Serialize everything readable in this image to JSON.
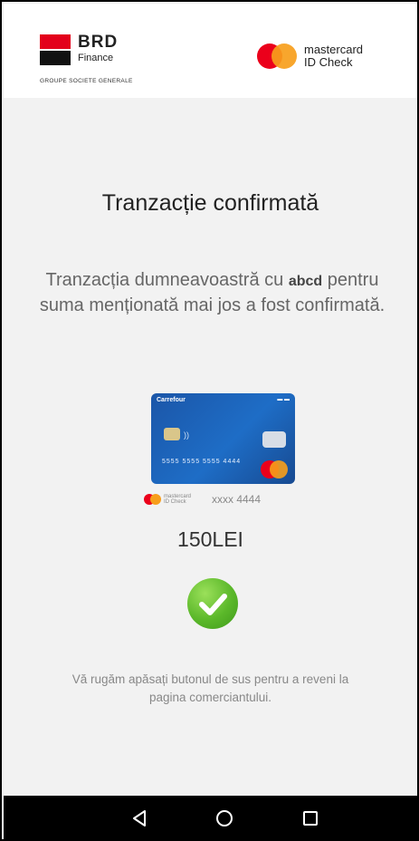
{
  "header": {
    "brd": {
      "name": "BRD",
      "sub": "Finance",
      "group": "GROUPE SOCIETE GENERALE"
    },
    "mastercard": {
      "line1": "mastercard",
      "line2": "ID Check"
    }
  },
  "content": {
    "title": "Tranzacție confirmată",
    "message_prefix": "Tranzacția dumneavoastră cu ",
    "merchant": "abcd",
    "message_suffix": " pentru suma menționată mai jos a fost confirmată.",
    "card_masked": "xxxx 4444",
    "amount": "150LEI",
    "instruction_line1": "Vă rugăm apăsați butonul de sus pentru a reveni la",
    "instruction_line2": "pagina comerciantului."
  },
  "card_art": {
    "brand": "Carrefour",
    "number": "5555 5555 5555 4444"
  },
  "navigation": {
    "back": "back-icon",
    "home": "home-icon",
    "recent": "recent-apps-icon"
  },
  "colors": {
    "brd_red": "#e3001b",
    "mastercard_red": "#eb001b",
    "mastercard_orange": "#f79e1b",
    "success_green": "#5bb82a"
  }
}
